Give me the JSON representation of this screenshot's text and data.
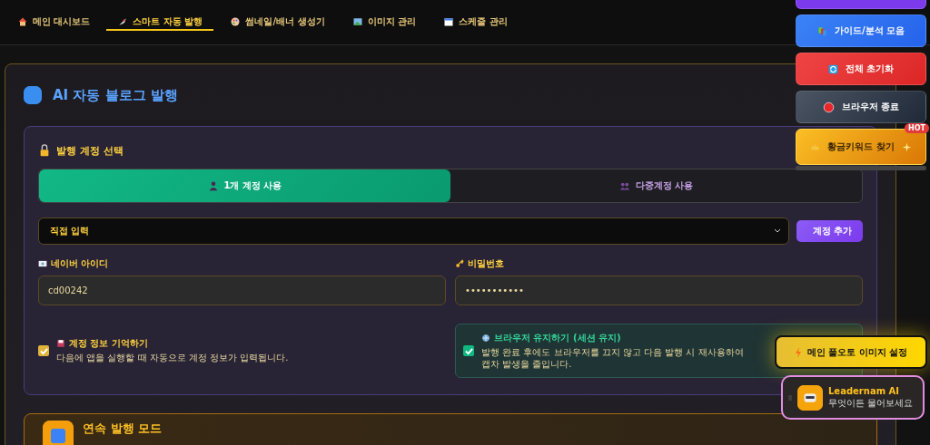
{
  "nav": {
    "tabs": [
      {
        "label": "메인 대시보드",
        "selected": false
      },
      {
        "label": "스마트 자동 발행",
        "selected": true
      },
      {
        "label": "썸네일/배너 생성기",
        "selected": false
      },
      {
        "label": "이미지 관리",
        "selected": false
      },
      {
        "label": "스케줄 관리",
        "selected": false
      }
    ]
  },
  "main": {
    "title": "AI 자동 블로그 발행",
    "account_panel": {
      "title": "발행 계정 선택",
      "modes": [
        {
          "label": "1개 계정 사용",
          "selected": true
        },
        {
          "label": "다중계정 사용",
          "selected": false
        }
      ],
      "account_select": {
        "value": "직접 입력"
      },
      "add_button": "계정 추가",
      "fields": [
        {
          "label": "네이버 아이디",
          "value": "cd00242"
        },
        {
          "label": "비밀번호",
          "value": "•••••••••••"
        }
      ],
      "options": [
        {
          "kind": "plain",
          "title": "계정 정보 기억하기",
          "description": "다음에 앱을 실행할 때 자동으로 계정 정보가 입력됩니다.",
          "checked": true
        },
        {
          "kind": "boxed",
          "title": "브라우저 유지하기 (세션 유지)",
          "description": "발행 완료 후에도 브라우저를 끄지 않고 다음 발행 시 재사용하여 캡차 발생을 줄입니다.",
          "checked": true
        }
      ]
    },
    "next_section": {
      "title": "연속 발행 모드"
    }
  },
  "side_buttons": [
    {
      "kind": "purple"
    },
    {
      "kind": "blue",
      "label": "가이드/분석 모음"
    },
    {
      "kind": "red",
      "label": "전체 초기화"
    },
    {
      "kind": "slate",
      "label": "브라우저 종료"
    },
    {
      "kind": "gold",
      "label": "황금키워드 찾기",
      "badge": "HOT"
    }
  ],
  "image_button": "메인 풀오토 이미지 설정",
  "assistant": {
    "name": "Leadernam AI",
    "subtitle": "무엇이든 물어보세요"
  }
}
